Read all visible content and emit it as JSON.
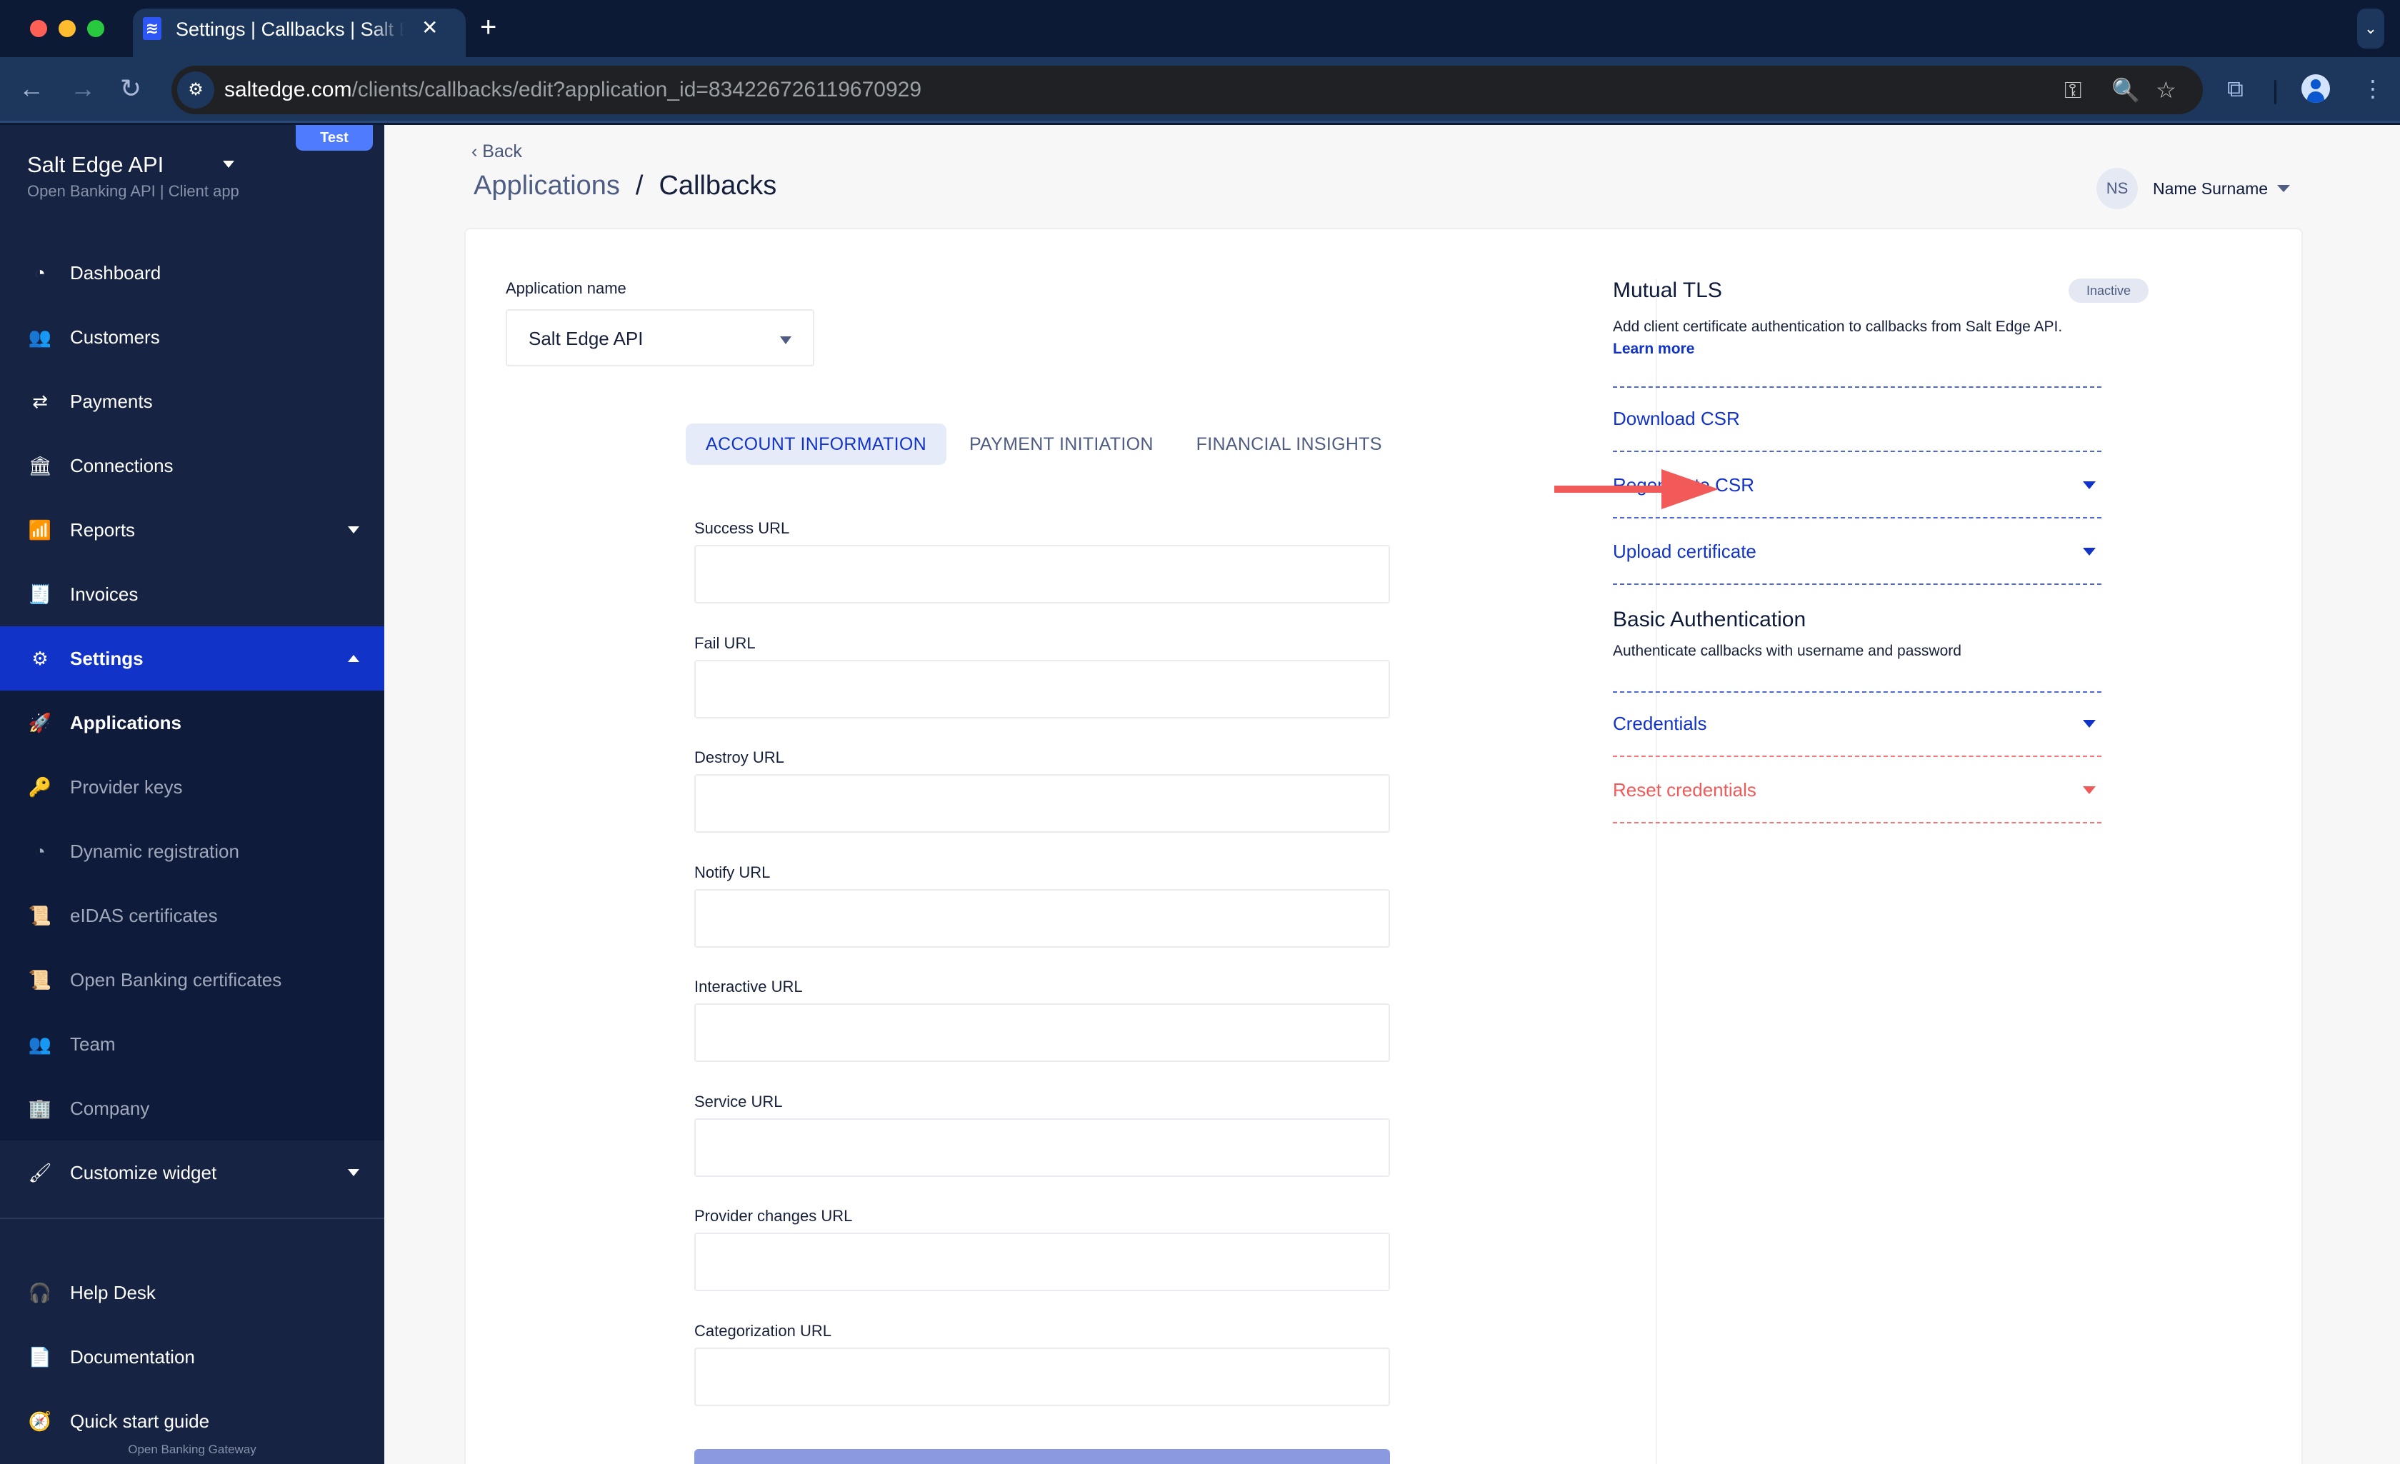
{
  "browser": {
    "tab_title": "Settings | Callbacks | Salt Edge",
    "tab_favicon": "saltedge-logo-icon",
    "url_host": "saltedge.com",
    "url_path": "/clients/callbacks/edit?application_id=834226726119670929",
    "icons": {
      "back": "←",
      "forward": "→",
      "reload": "↻",
      "site_info": "⚙",
      "password_key": "⚿",
      "zoom": "🔍",
      "bookmark": "☆",
      "extensions": "⧉",
      "menu": "⋮",
      "tab_close": "✕",
      "new_tab": "+",
      "tab_search": "⌄"
    }
  },
  "sidebar": {
    "env_badge": "Test",
    "brand_title": "Salt Edge API",
    "brand_subtitle": "Open Banking API | Client app",
    "items": [
      {
        "label": "Dashboard",
        "icon": "◔"
      },
      {
        "label": "Customers",
        "icon": "👥"
      },
      {
        "label": "Payments",
        "icon": "⇄"
      },
      {
        "label": "Connections",
        "icon": "🏛"
      },
      {
        "label": "Reports",
        "icon": "📶"
      },
      {
        "label": "Invoices",
        "icon": "🧾"
      },
      {
        "label": "Settings",
        "icon": "⚙"
      }
    ],
    "settings_subitems": [
      {
        "label": "Applications",
        "icon": "🚀"
      },
      {
        "label": "Provider keys",
        "icon": "🔑"
      },
      {
        "label": "Dynamic registration",
        "icon": "◔"
      },
      {
        "label": "eIDAS certificates",
        "icon": "📜"
      },
      {
        "label": "Open Banking certificates",
        "icon": "📜"
      },
      {
        "label": "Team",
        "icon": "👥"
      },
      {
        "label": "Company",
        "icon": "🏢"
      }
    ],
    "customize_widget": {
      "label": "Customize widget",
      "icon": "🖌"
    },
    "bottom_items": [
      {
        "label": "Help Desk",
        "icon": "🎧"
      },
      {
        "label": "Documentation",
        "icon": "📄"
      },
      {
        "label": "Quick start guide",
        "icon": "🧭"
      }
    ],
    "footer": "Open Banking Gateway"
  },
  "header": {
    "back_label": "Back",
    "breadcrumb_parent": "Applications",
    "breadcrumb_separator": "/",
    "breadcrumb_current": "Callbacks",
    "user_initials": "NS",
    "user_name": "Name Surname"
  },
  "form": {
    "app_name_label": "Application name",
    "app_name_value": "Salt Edge API",
    "tabs": [
      {
        "label": "ACCOUNT INFORMATION",
        "active": true
      },
      {
        "label": "PAYMENT INITIATION",
        "active": false
      },
      {
        "label": "FINANCIAL INSIGHTS",
        "active": false
      }
    ],
    "fields": [
      {
        "label": "Success URL",
        "value": ""
      },
      {
        "label": "Fail URL",
        "value": ""
      },
      {
        "label": "Destroy URL",
        "value": ""
      },
      {
        "label": "Notify URL",
        "value": ""
      },
      {
        "label": "Interactive URL",
        "value": ""
      },
      {
        "label": "Service URL",
        "value": ""
      },
      {
        "label": "Provider changes URL",
        "value": ""
      },
      {
        "label": "Categorization URL",
        "value": ""
      }
    ]
  },
  "mutual_tls": {
    "title": "Mutual TLS",
    "status": "Inactive",
    "description": "Add client certificate authentication to callbacks from Salt Edge API.",
    "learn_more": "Learn more",
    "actions": [
      {
        "label": "Download CSR",
        "expandable": false
      },
      {
        "label": "Regenerate CSR",
        "expandable": true
      },
      {
        "label": "Upload certificate",
        "expandable": true
      }
    ]
  },
  "basic_auth": {
    "title": "Basic Authentication",
    "description": "Authenticate callbacks with username and password",
    "actions": [
      {
        "label": "Credentials",
        "expandable": true,
        "danger": false
      },
      {
        "label": "Reset credentials",
        "expandable": true,
        "danger": true
      }
    ]
  },
  "colors": {
    "primary": "#1133c8",
    "danger": "#f25a5a",
    "sidebar_bg": "#162343",
    "annotation_arrow": "#f25a5a"
  }
}
